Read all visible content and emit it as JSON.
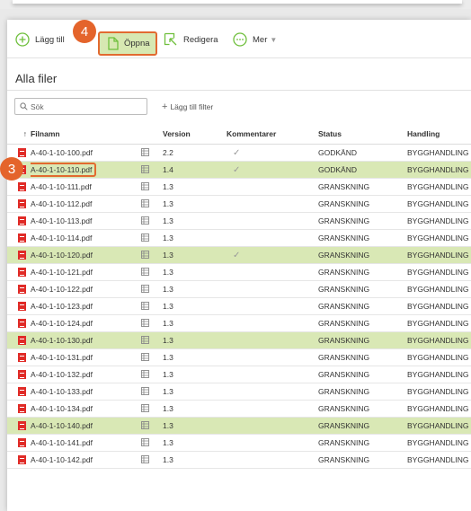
{
  "toolbar": {
    "add_label": "Lägg till",
    "open_label": "Öppna",
    "edit_label": "Redigera",
    "more_label": "Mer"
  },
  "page_title": "Alla filer",
  "search": {
    "placeholder": "Sök"
  },
  "add_filter_label": "Lägg till filter",
  "columns": {
    "sort_arrow": "↑",
    "filename": "Filnamn",
    "version": "Version",
    "comments": "Kommentarer",
    "status": "Status",
    "handling": "Handling"
  },
  "rows": [
    {
      "name": "A-40-1-10-100.pdf",
      "version": "2.2",
      "comment": "✓",
      "status": "GODKÄND",
      "handling": "BYGGHANDLING"
    },
    {
      "name": "A-40-1-10-110.pdf",
      "version": "1.4",
      "comment": "✓",
      "status": "GODKÄND",
      "handling": "BYGGHANDLING"
    },
    {
      "name": "A-40-1-10-111.pdf",
      "version": "1.3",
      "comment": "",
      "status": "GRANSKNING",
      "handling": "BYGGHANDLING"
    },
    {
      "name": "A-40-1-10-112.pdf",
      "version": "1.3",
      "comment": "",
      "status": "GRANSKNING",
      "handling": "BYGGHANDLING"
    },
    {
      "name": "A-40-1-10-113.pdf",
      "version": "1.3",
      "comment": "",
      "status": "GRANSKNING",
      "handling": "BYGGHANDLING"
    },
    {
      "name": "A-40-1-10-114.pdf",
      "version": "1.3",
      "comment": "",
      "status": "GRANSKNING",
      "handling": "BYGGHANDLING"
    },
    {
      "name": "A-40-1-10-120.pdf",
      "version": "1.3",
      "comment": "✓",
      "status": "GRANSKNING",
      "handling": "BYGGHANDLING"
    },
    {
      "name": "A-40-1-10-121.pdf",
      "version": "1.3",
      "comment": "",
      "status": "GRANSKNING",
      "handling": "BYGGHANDLING"
    },
    {
      "name": "A-40-1-10-122.pdf",
      "version": "1.3",
      "comment": "",
      "status": "GRANSKNING",
      "handling": "BYGGHANDLING"
    },
    {
      "name": "A-40-1-10-123.pdf",
      "version": "1.3",
      "comment": "",
      "status": "GRANSKNING",
      "handling": "BYGGHANDLING"
    },
    {
      "name": "A-40-1-10-124.pdf",
      "version": "1.3",
      "comment": "",
      "status": "GRANSKNING",
      "handling": "BYGGHANDLING"
    },
    {
      "name": "A-40-1-10-130.pdf",
      "version": "1.3",
      "comment": "",
      "status": "GRANSKNING",
      "handling": "BYGGHANDLING"
    },
    {
      "name": "A-40-1-10-131.pdf",
      "version": "1.3",
      "comment": "",
      "status": "GRANSKNING",
      "handling": "BYGGHANDLING"
    },
    {
      "name": "A-40-1-10-132.pdf",
      "version": "1.3",
      "comment": "",
      "status": "GRANSKNING",
      "handling": "BYGGHANDLING"
    },
    {
      "name": "A-40-1-10-133.pdf",
      "version": "1.3",
      "comment": "",
      "status": "GRANSKNING",
      "handling": "BYGGHANDLING"
    },
    {
      "name": "A-40-1-10-134.pdf",
      "version": "1.3",
      "comment": "",
      "status": "GRANSKNING",
      "handling": "BYGGHANDLING"
    },
    {
      "name": "A-40-1-10-140.pdf",
      "version": "1.3",
      "comment": "",
      "status": "GRANSKNING",
      "handling": "BYGGHANDLING"
    },
    {
      "name": "A-40-1-10-141.pdf",
      "version": "1.3",
      "comment": "",
      "status": "GRANSKNING",
      "handling": "BYGGHANDLING"
    },
    {
      "name": "A-40-1-10-142.pdf",
      "version": "1.3",
      "comment": "",
      "status": "GRANSKNING",
      "handling": "BYGGHANDLING"
    }
  ],
  "callouts": {
    "row_marker": "3",
    "open_marker": "4"
  },
  "colors": {
    "accent_green": "#6fbf3c",
    "highlight": "#d9e8b5",
    "callout": "#e4642b",
    "pdf_red": "#e02b27"
  },
  "icons": {
    "add": "plus-circle-icon",
    "open": "file-icon",
    "edit": "edit-icon",
    "more": "more-icon",
    "search": "search-icon",
    "file_type": "pdf-icon",
    "preview": "preview-icon",
    "comment": "check-icon"
  }
}
